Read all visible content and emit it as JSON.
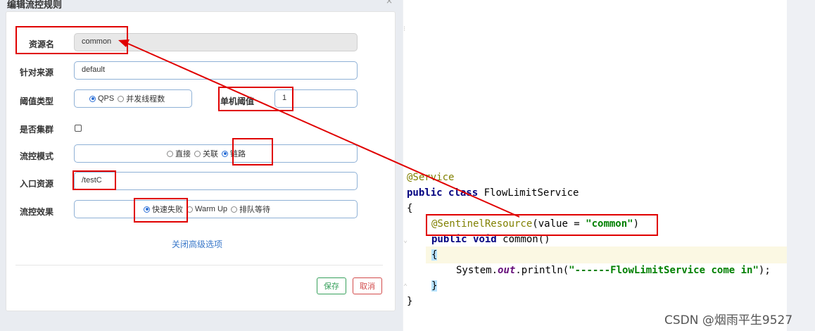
{
  "dialog": {
    "title": "编辑流控规则",
    "close_glyph": "×",
    "fields": {
      "resource_name": {
        "label": "资源名",
        "value": "common"
      },
      "limit_app": {
        "label": "针对来源",
        "value": "default"
      },
      "grade": {
        "label": "阈值类型",
        "options": [
          {
            "label": "QPS",
            "selected": true
          },
          {
            "label": "并发线程数",
            "selected": false
          }
        ]
      },
      "threshold": {
        "label": "单机阈值",
        "value": "1"
      },
      "cluster": {
        "label": "是否集群",
        "checked": false
      },
      "strategy": {
        "label": "流控模式",
        "options": [
          {
            "label": "直接",
            "selected": false
          },
          {
            "label": "关联",
            "selected": false
          },
          {
            "label": "链路",
            "selected": true
          }
        ]
      },
      "ref_resource": {
        "label": "入口资源",
        "value": "/testC"
      },
      "control_behavior": {
        "label": "流控效果",
        "options": [
          {
            "label": "快速失败",
            "selected": true
          },
          {
            "label": "Warm Up",
            "selected": false
          },
          {
            "label": "排队等待",
            "selected": false
          }
        ]
      }
    },
    "advanced_link": "关闭高级选项",
    "buttons": {
      "save": "保存",
      "cancel": "取消"
    }
  },
  "code": {
    "line1": "@Service",
    "line2_kw1": "public",
    "line2_kw2": "class",
    "line2_name": " FlowLimitService",
    "line3": "{",
    "line4_ann": "@SentinelResource",
    "line4_open": "(value = ",
    "line4_str": "\"common\"",
    "line4_close": ")",
    "line5_kw1": "public",
    "line5_kw2": "void",
    "line5_rest": " common()",
    "line6": "{",
    "line7_pre": "System.",
    "line7_out": "out",
    "line7_mid": ".println(",
    "line7_str": "\"------FlowLimitService come in\"",
    "line7_end": ");",
    "line8": "}",
    "line9": "}"
  },
  "watermark": "CSDN @烟雨平生9527",
  "colors": {
    "annotation_box": "#e00000",
    "keyword": "#000080",
    "annotation": "#808000",
    "string": "#008000",
    "save_button": "#36a05b",
    "cancel_button": "#d24b4b"
  }
}
